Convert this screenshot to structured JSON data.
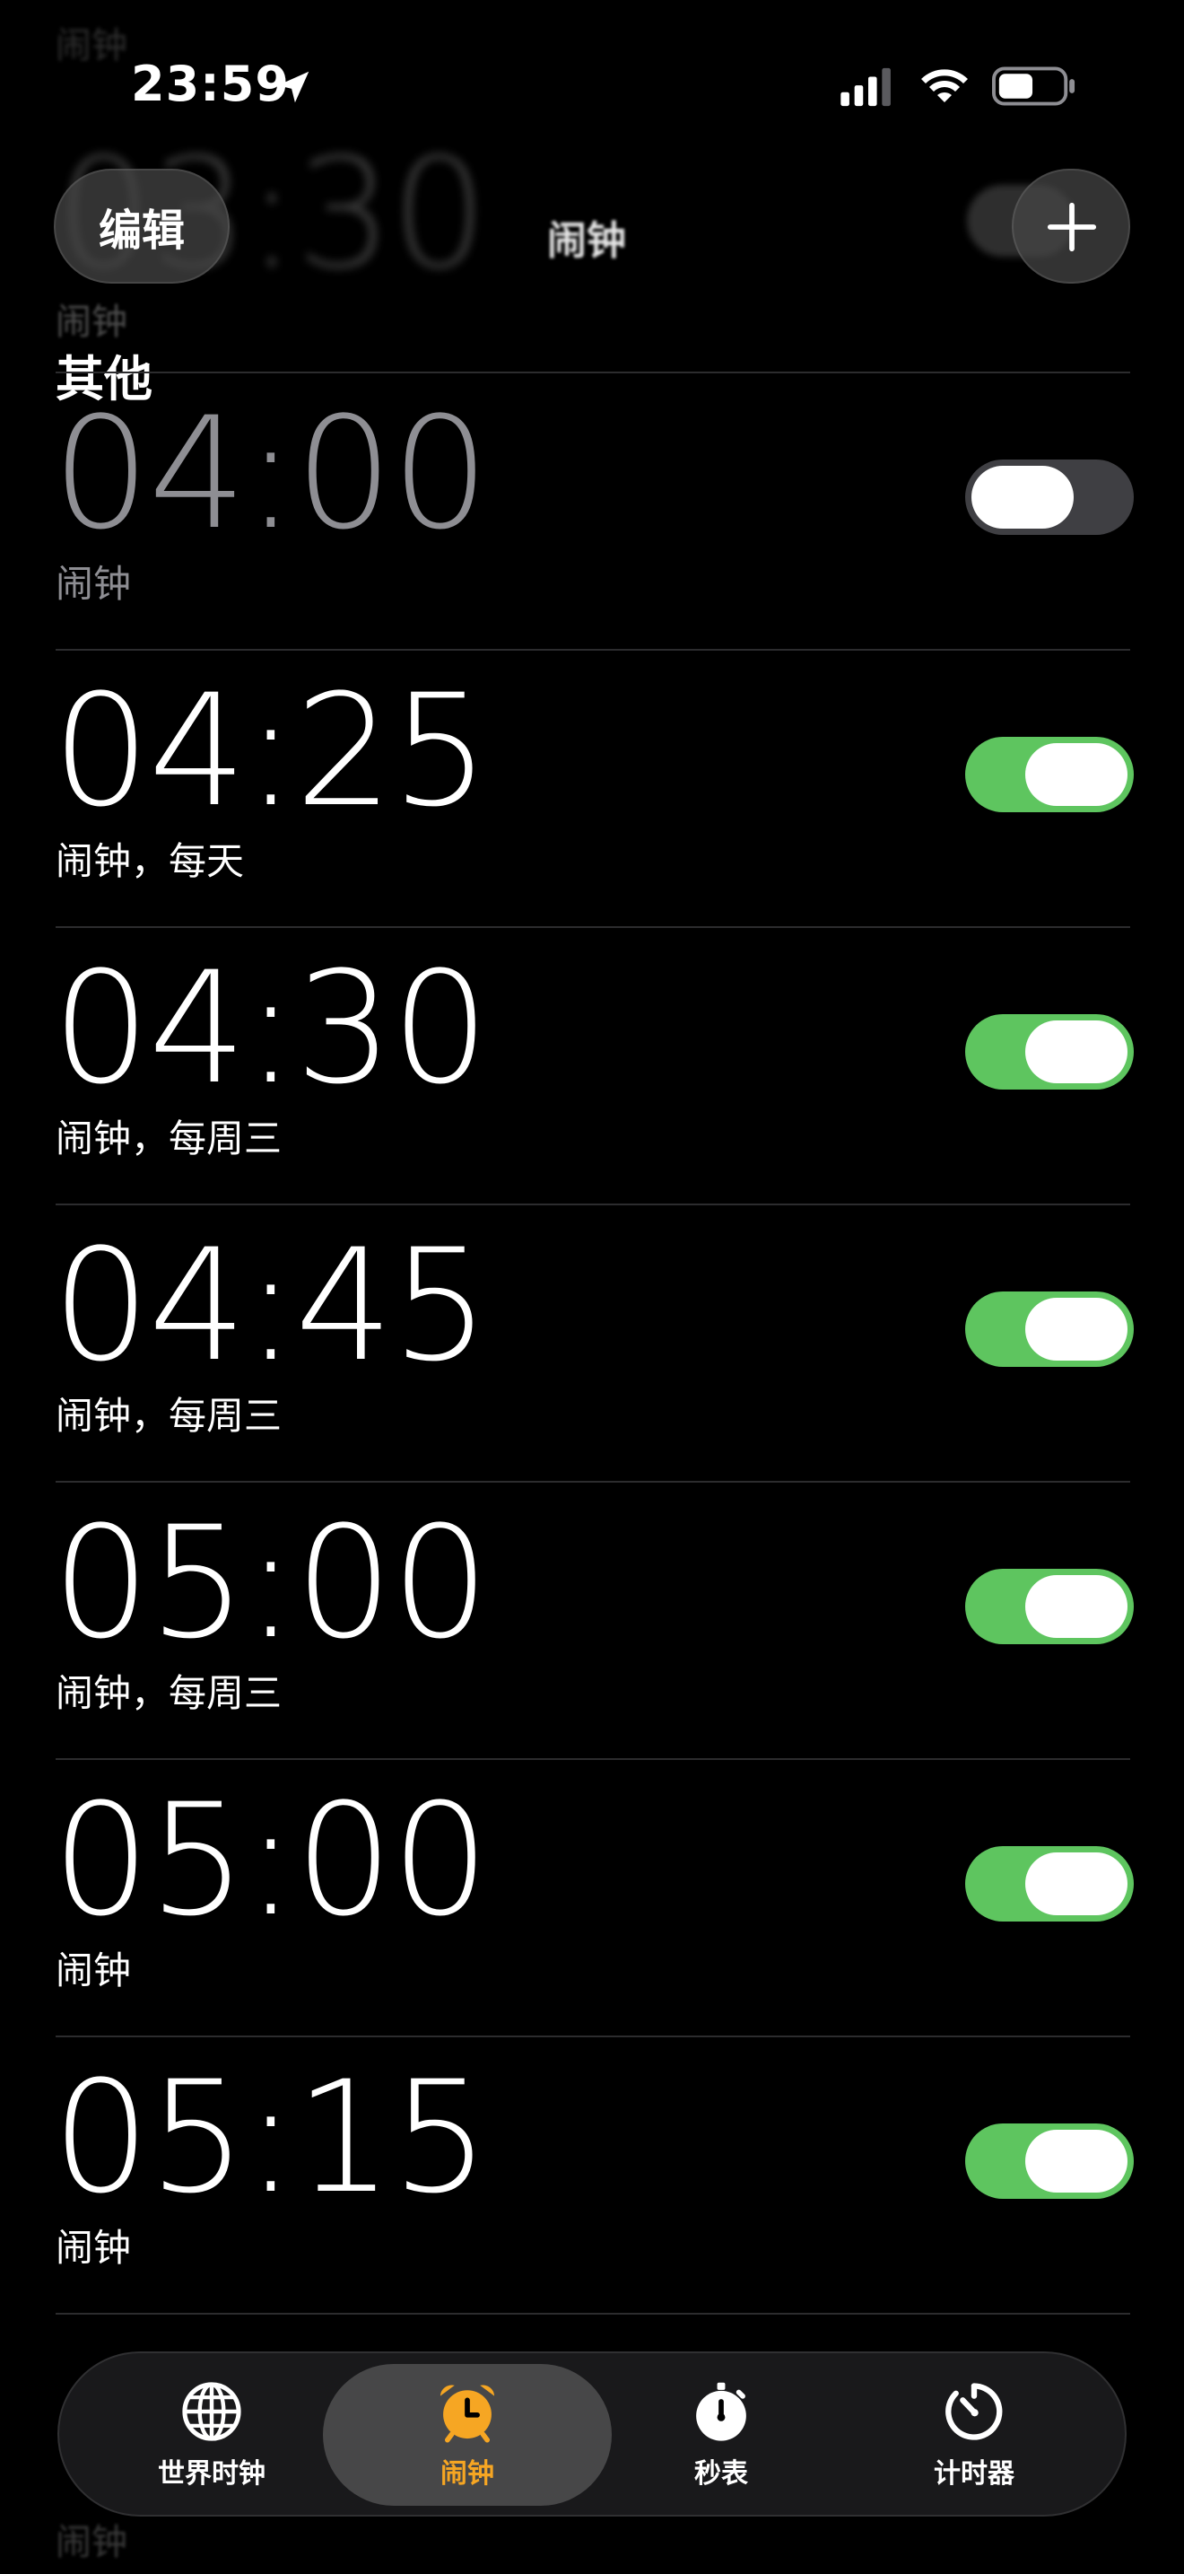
{
  "status_bar": {
    "time": "23:59",
    "icons": [
      "location-arrow-icon",
      "cellular-signal-icon",
      "wifi-icon",
      "battery-icon"
    ]
  },
  "header": {
    "edit_label": "编辑",
    "add_icon": "plus-icon",
    "title": "闹钟"
  },
  "ghost_alarm": {
    "time": "03:30",
    "label": "闹钟"
  },
  "section": {
    "title": "其他"
  },
  "alarms": [
    {
      "time": "04:00",
      "label": "闹钟",
      "enabled": false
    },
    {
      "time": "04:25",
      "label": "闹钟，每天",
      "enabled": true
    },
    {
      "time": "04:30",
      "label": "闹钟，每周三",
      "enabled": true
    },
    {
      "time": "04:45",
      "label": "闹钟，每周三",
      "enabled": true
    },
    {
      "time": "05:00",
      "label": "闹钟，每周三",
      "enabled": true
    },
    {
      "time": "05:00",
      "label": "闹钟",
      "enabled": true
    },
    {
      "time": "05:15",
      "label": "闹钟",
      "enabled": true
    }
  ],
  "ghost_bottom_label": "闹钟",
  "tab_bar": {
    "tabs": [
      {
        "label": "世界时钟",
        "icon": "globe-icon",
        "active": false
      },
      {
        "label": "闹钟",
        "icon": "alarm-clock-icon",
        "active": true
      },
      {
        "label": "秒表",
        "icon": "stopwatch-icon",
        "active": false
      },
      {
        "label": "计时器",
        "icon": "timer-icon",
        "active": false
      }
    ]
  },
  "colors": {
    "background": "#000000",
    "toggle_on": "#5ec55f",
    "toggle_off": "#3f3f43",
    "active_tab": "#f6a623",
    "inactive_text": "#8e8e93",
    "separator": "#2c2c2e"
  }
}
